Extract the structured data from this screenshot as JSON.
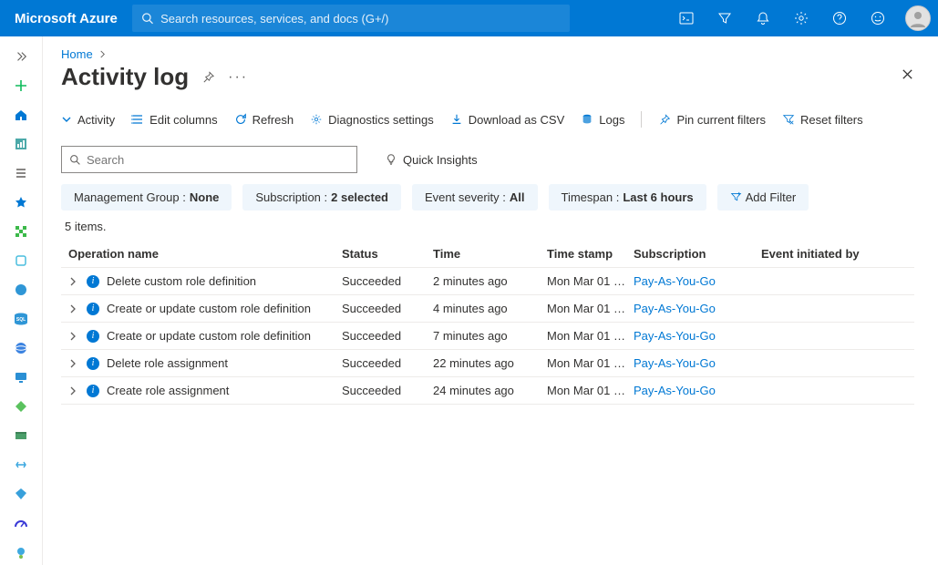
{
  "brand": "Microsoft Azure",
  "search_placeholder": "Search resources, services, and docs (G+/)",
  "breadcrumb": {
    "home": "Home"
  },
  "page_title": "Activity log",
  "toolbar": {
    "activity": "Activity",
    "edit_columns": "Edit columns",
    "refresh": "Refresh",
    "diagnostics": "Diagnostics settings",
    "download_csv": "Download as CSV",
    "logs": "Logs",
    "pin_filters": "Pin current filters",
    "reset_filters": "Reset filters"
  },
  "local_search_placeholder": "Search",
  "quick_insights": "Quick Insights",
  "filters": {
    "mg_label": "Management Group : ",
    "mg_value": "None",
    "sub_label": "Subscription : ",
    "sub_value": "2 selected",
    "sev_label": "Event severity : ",
    "sev_value": "All",
    "ts_label": "Timespan : ",
    "ts_value": "Last 6 hours",
    "add_filter": "Add Filter"
  },
  "items_count": "5 items.",
  "columns": {
    "op": "Operation name",
    "status": "Status",
    "time": "Time",
    "stamp": "Time stamp",
    "sub": "Subscription",
    "init": "Event initiated by"
  },
  "rows": [
    {
      "op": "Delete custom role definition",
      "status": "Succeeded",
      "time": "2 minutes ago",
      "stamp": "Mon Mar 01 …",
      "sub": "Pay-As-You-Go",
      "init": ""
    },
    {
      "op": "Create or update custom role definition",
      "status": "Succeeded",
      "time": "4 minutes ago",
      "stamp": "Mon Mar 01 …",
      "sub": "Pay-As-You-Go",
      "init": ""
    },
    {
      "op": "Create or update custom role definition",
      "status": "Succeeded",
      "time": "7 minutes ago",
      "stamp": "Mon Mar 01 …",
      "sub": "Pay-As-You-Go",
      "init": ""
    },
    {
      "op": "Delete role assignment",
      "status": "Succeeded",
      "time": "22 minutes ago",
      "stamp": "Mon Mar 01 …",
      "sub": "Pay-As-You-Go",
      "init": ""
    },
    {
      "op": "Create role assignment",
      "status": "Succeeded",
      "time": "24 minutes ago",
      "stamp": "Mon Mar 01 …",
      "sub": "Pay-As-You-Go",
      "init": ""
    }
  ]
}
